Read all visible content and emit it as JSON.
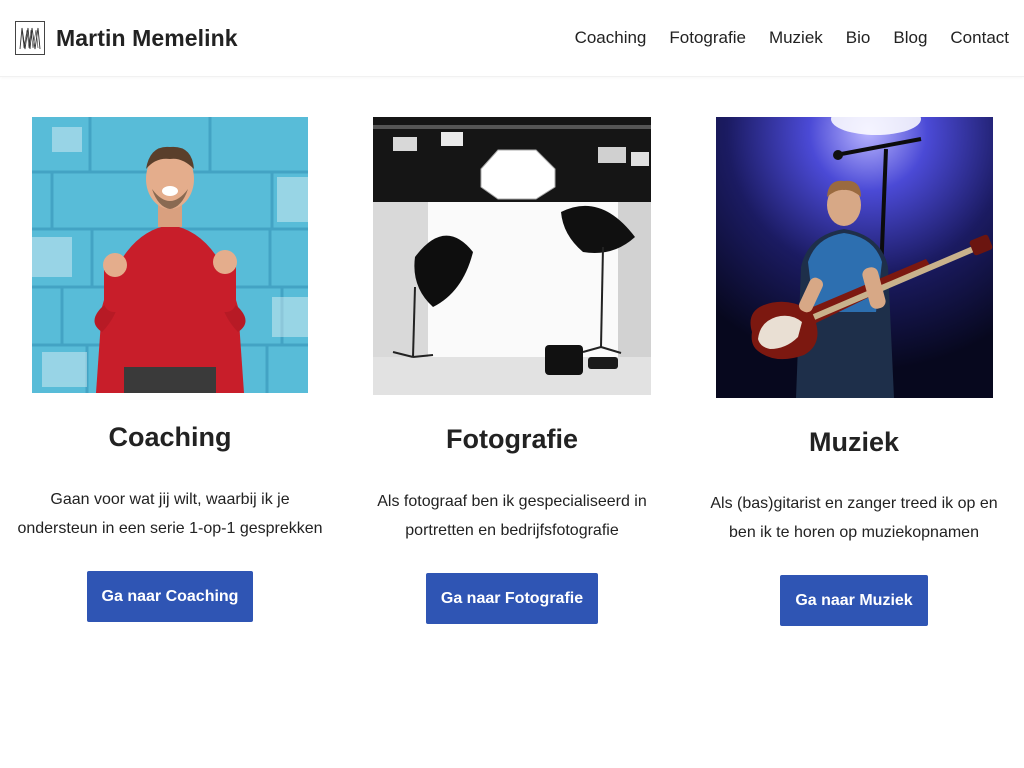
{
  "site": {
    "title": "Martin Memelink",
    "logo_icon": "mm-monogram-icon"
  },
  "nav": {
    "items": [
      {
        "label": "Coaching"
      },
      {
        "label": "Fotografie"
      },
      {
        "label": "Muziek"
      },
      {
        "label": "Bio"
      },
      {
        "label": "Blog"
      },
      {
        "label": "Contact"
      }
    ]
  },
  "cards": [
    {
      "title": "Coaching",
      "description_line1": "Gaan voor wat jij wilt, waarbij ik je",
      "description_line2": "ondersteun in een serie 1-op-1 gesprekken",
      "button": "Ga naar Coaching",
      "photo": "man in red sweater cheering against blue brick wall"
    },
    {
      "title": "Fotografie",
      "description_line1": "Als fotograaf ben ik gespecialiseerd in",
      "description_line2": "portretten en bedrijfsfotografie",
      "button": "Ga naar Fotografie",
      "photo": "photo studio with lights and white backdrop"
    },
    {
      "title": "Muziek",
      "description_line1": "Als (bas)gitarist en zanger treed ik op en",
      "description_line2": "ben ik te horen op muziekopnamen",
      "button": "Ga naar Muziek",
      "photo": "bass guitarist performing on stage under blue light"
    }
  ],
  "colors": {
    "button_bg": "#2f55b4",
    "button_text": "#ffffff",
    "text": "#222222"
  }
}
